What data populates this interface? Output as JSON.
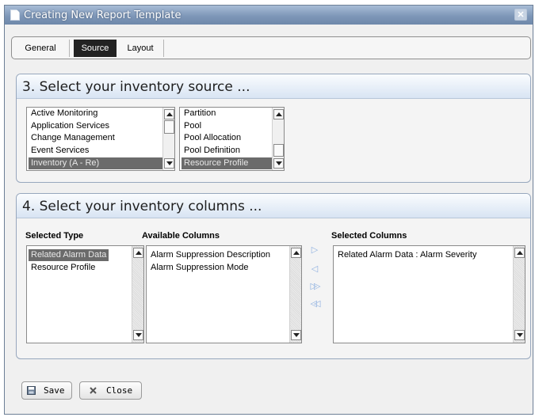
{
  "window": {
    "title": "Creating New Report Template"
  },
  "tabs": [
    {
      "label": "General",
      "active": false
    },
    {
      "label": "Source",
      "active": true
    },
    {
      "label": "Layout",
      "active": false
    }
  ],
  "source_section": {
    "title": "3. Select your inventory source ...",
    "source_list": [
      "Active Monitoring",
      "Application Services",
      "Change Management",
      "Event Services",
      "Inventory (A - Re)"
    ],
    "source_selected": "Inventory (A - Re)",
    "entity_list": [
      "Partition",
      "Pool",
      "Pool Allocation",
      "Pool Definition",
      "Resource Profile"
    ],
    "entity_selected": "Resource Profile"
  },
  "columns_section": {
    "title": "4. Select your inventory columns ...",
    "selected_type_label": "Selected Type",
    "available_columns_label": "Available Columns",
    "selected_columns_label": "Selected Columns",
    "selected_type_list": [
      "Related Alarm Data",
      "Resource Profile"
    ],
    "selected_type_selected": "Related Alarm Data",
    "available_columns_list": [
      "Alarm Suppression Description",
      "Alarm Suppression Mode"
    ],
    "selected_columns_list": [
      "Related Alarm Data : Alarm Severity"
    ],
    "move_buttons": [
      {
        "name": "move-right-icon",
        "glyph": "▷"
      },
      {
        "name": "move-left-icon",
        "glyph": "◁"
      },
      {
        "name": "move-all-right-icon",
        "glyph": "▷▷"
      },
      {
        "name": "move-all-left-icon",
        "glyph": "◁◁"
      }
    ]
  },
  "footer": {
    "save_label": "Save",
    "close_label": "Close"
  },
  "colors": {
    "titlebar": "#7e97b8",
    "selection": "#6b6b6b",
    "panel_header": "#d8e4f3",
    "move_arrow": "#8fb1e0"
  }
}
